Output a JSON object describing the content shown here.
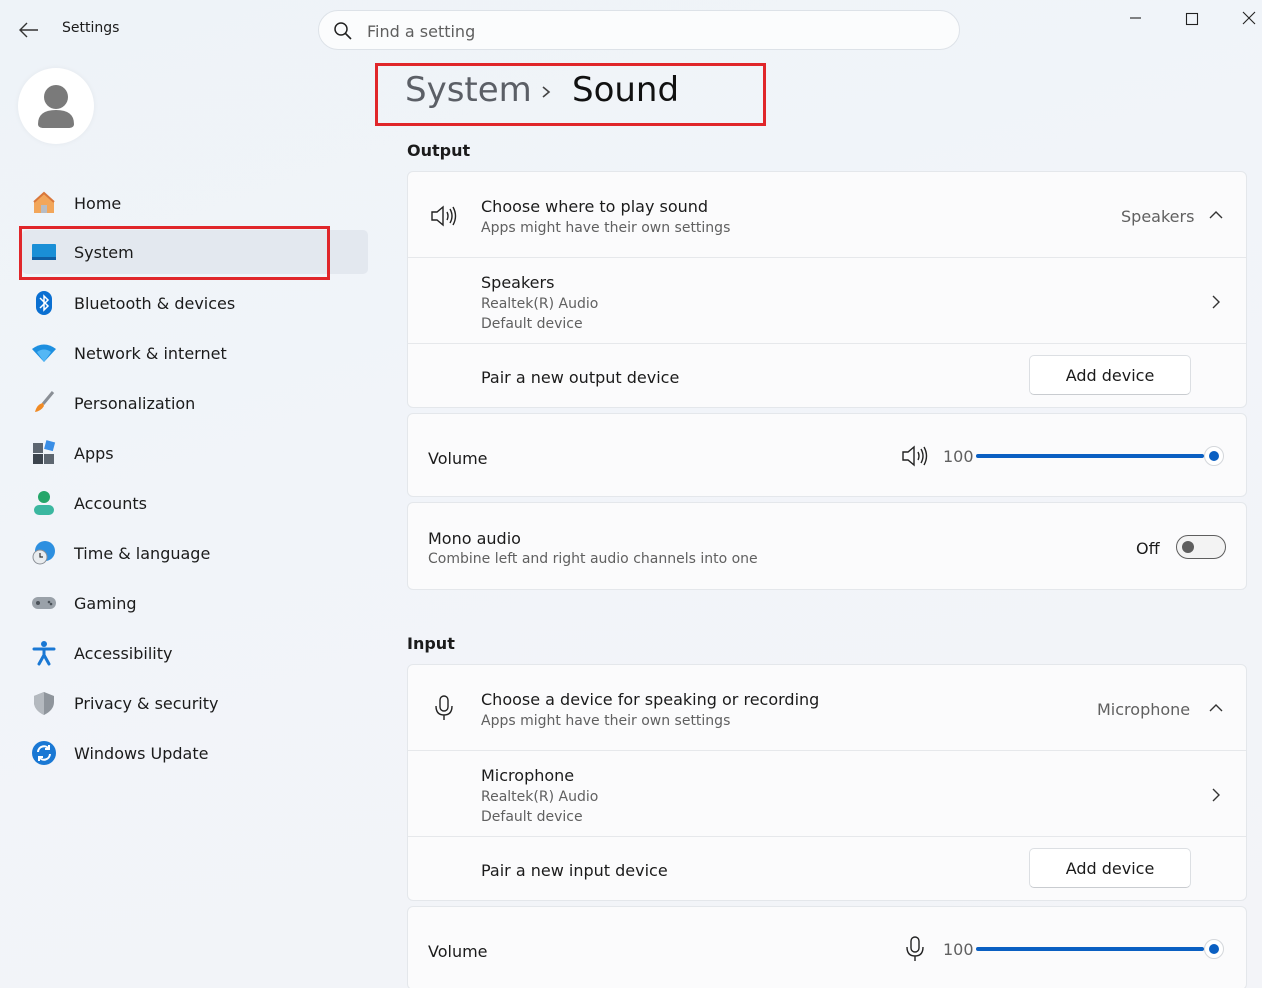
{
  "app": {
    "title": "Settings"
  },
  "search": {
    "placeholder": "Find a setting"
  },
  "sidebar": {
    "items": [
      {
        "label": "Home",
        "icon": "home-icon"
      },
      {
        "label": "System",
        "icon": "system-icon",
        "selected": true
      },
      {
        "label": "Bluetooth & devices",
        "icon": "bluetooth-icon"
      },
      {
        "label": "Network & internet",
        "icon": "wifi-icon"
      },
      {
        "label": "Personalization",
        "icon": "paintbrush-icon"
      },
      {
        "label": "Apps",
        "icon": "apps-icon"
      },
      {
        "label": "Accounts",
        "icon": "accounts-icon"
      },
      {
        "label": "Time & language",
        "icon": "clock-globe-icon"
      },
      {
        "label": "Gaming",
        "icon": "gamepad-icon"
      },
      {
        "label": "Accessibility",
        "icon": "accessibility-icon"
      },
      {
        "label": "Privacy & security",
        "icon": "shield-icon"
      },
      {
        "label": "Windows Update",
        "icon": "update-icon"
      }
    ]
  },
  "breadcrumb": {
    "parent": "System",
    "current": "Sound"
  },
  "output": {
    "section_title": "Output",
    "choose": {
      "title": "Choose where to play sound",
      "subtitle": "Apps might have their own settings",
      "value": "Speakers"
    },
    "device": {
      "name": "Speakers",
      "driver": "Realtek(R) Audio",
      "status": "Default device"
    },
    "pair": {
      "label": "Pair a new output device",
      "button": "Add device"
    },
    "volume": {
      "label": "Volume",
      "value": "100",
      "level_percent": 100
    },
    "mono": {
      "title": "Mono audio",
      "subtitle": "Combine left and right audio channels into one",
      "state": "Off"
    }
  },
  "input": {
    "section_title": "Input",
    "choose": {
      "title": "Choose a device for speaking or recording",
      "subtitle": "Apps might have their own settings",
      "value": "Microphone"
    },
    "device": {
      "name": "Microphone",
      "driver": "Realtek(R) Audio",
      "status": "Default device"
    },
    "pair": {
      "label": "Pair a new input device",
      "button": "Add device"
    },
    "volume": {
      "label": "Volume",
      "value": "100",
      "level_percent": 100
    }
  },
  "colors": {
    "accent": "#0a5fc2",
    "highlight": "#e0262a"
  }
}
